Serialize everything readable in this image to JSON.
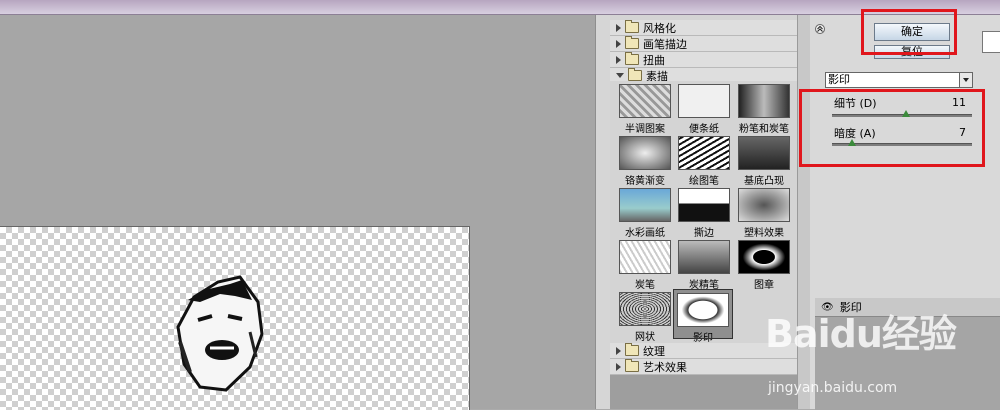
{
  "buttons": {
    "ok": "确定",
    "reset": "复位"
  },
  "categories": {
    "top": [
      {
        "label": "风格化"
      },
      {
        "label": "画笔描边"
      },
      {
        "label": "扭曲"
      },
      {
        "label": "素描"
      }
    ],
    "bottom": [
      {
        "label": "纹理"
      },
      {
        "label": "艺术效果"
      }
    ]
  },
  "thumbnails": [
    {
      "label": "半调图案"
    },
    {
      "label": "便条纸"
    },
    {
      "label": "粉笔和炭笔"
    },
    {
      "label": "铬黄渐变"
    },
    {
      "label": "绘图笔"
    },
    {
      "label": "基底凸现"
    },
    {
      "label": "水彩画纸"
    },
    {
      "label": "撕边"
    },
    {
      "label": "塑料效果"
    },
    {
      "label": "炭笔"
    },
    {
      "label": "炭精笔"
    },
    {
      "label": "图章"
    },
    {
      "label": "网状"
    },
    {
      "label": "影印"
    }
  ],
  "filter_select": {
    "value": "影印"
  },
  "sliders": [
    {
      "label": "细节 (D)",
      "value": "11",
      "fraction": 0.53
    },
    {
      "label": "暗度 (A)",
      "value": "7",
      "fraction": 0.14
    }
  ],
  "layers": {
    "first_layer": "影印"
  },
  "watermark": {
    "brand": "Baidu经验",
    "url": "jingyan.baidu.com"
  },
  "colors": {
    "highlight": "#e0161c",
    "selected_thumb": "#8f8f8f"
  }
}
